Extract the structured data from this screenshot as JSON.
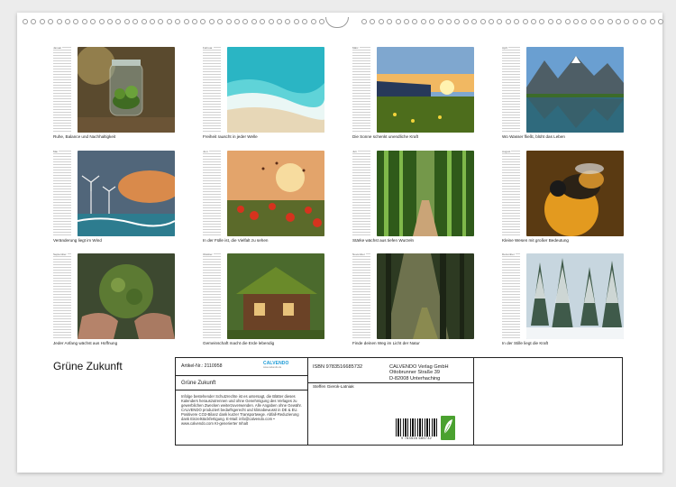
{
  "calendar": {
    "title": "Grüne Zukunft",
    "months": [
      {
        "name": "Januar",
        "caption": "Ruhe, Balance und Nachhaltigkeit",
        "image": "plant-terrarium-jar"
      },
      {
        "name": "Februar",
        "caption": "Freiheit rauscht in jeder Welle",
        "image": "turquoise-ocean-wave"
      },
      {
        "name": "März",
        "caption": "Die Sonne schenkt unendliche Kraft",
        "image": "solar-panels-sunset-meadow"
      },
      {
        "name": "April",
        "caption": "Wo Wasser fließt, blüht das Leben",
        "image": "mountain-lake-reflection"
      },
      {
        "name": "Mai",
        "caption": "Veränderung liegt im Wind",
        "image": "wind-turbines-stormy-sky"
      },
      {
        "name": "Juni",
        "caption": "In der Fülle ist, die Vielfalt zu sehen",
        "image": "poppy-field-butterflies"
      },
      {
        "name": "Juli",
        "caption": "Stärke wächst aus tiefen Wurzeln",
        "image": "bamboo-forest-path"
      },
      {
        "name": "August",
        "caption": "Kleine Wesen mit großer Bedeutung",
        "image": "honeybee-on-flower"
      },
      {
        "name": "September",
        "caption": "Jeder Anfang wächst aus Hoffnung",
        "image": "hands-holding-leaf-globe"
      },
      {
        "name": "Oktober",
        "caption": "Gemeinschaft macht die Erde lebendig",
        "image": "moss-roof-wooden-cabin"
      },
      {
        "name": "November",
        "caption": "Finde deinen Weg im Licht der Natur",
        "image": "sunlit-forest-trail"
      },
      {
        "name": "Dezember",
        "caption": "In der Stille liegt die Kraft",
        "image": "snowy-pine-forest"
      }
    ]
  },
  "info": {
    "article_no": "Artikel-Nr.: 2110958",
    "logo": "CALVENDO",
    "logo_sub": "www.calvendo.de",
    "subtitle": "Grüne Zukunft",
    "legal": "Infolge bestehender Schutzrechte ist es untersagt, die Blätter dieses Kalenders herauszutrennen und ohne Genehmigung des Verlages zu gewerblichen Zwecken weiterzuverwenden. Alle Angaben ohne Gewähr. CALVENDO produziert bedarfsgerecht und klimabewusst in DE & EU. Positivere CO2-Bilanz dank kurzer Transportwege. Abfall-Reduzierung dank Einzelstückfertigung. E-Mail: info@calvendo.com • www.calvendo.com KI-generierter Inhalt",
    "isbn": "ISBN 9783516685732",
    "publisher": [
      "CALVENDO Verlag GmbH",
      "Ottobrunner Straße 39",
      "D-82008 Unterhaching"
    ],
    "author": "Steffen Gierok-Latniak",
    "barcode_number": "9 783516 685732"
  }
}
